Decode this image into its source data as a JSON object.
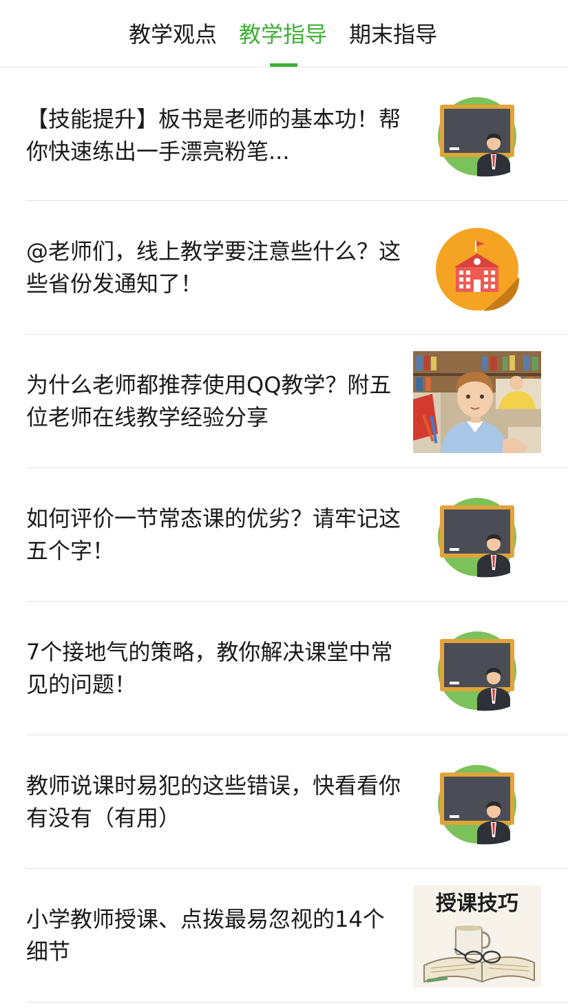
{
  "tabs": [
    {
      "label": "教学观点",
      "active": false
    },
    {
      "label": "教学指导",
      "active": true
    },
    {
      "label": "期末指导",
      "active": false
    }
  ],
  "accent_color": "#3cb035",
  "articles": [
    {
      "title": "【技能提升】板书是老师的基本功！帮你快速练出一手漂亮粉笔...",
      "thumbnail": "teacher-blackboard-icon"
    },
    {
      "title": "@老师们，线上教学要注意些什么？这些省份发通知了！",
      "thumbnail": "school-building-icon"
    },
    {
      "title": "为什么老师都推荐使用QQ教学？附五位老师在线教学经验分享",
      "thumbnail": "classroom-boy-photo"
    },
    {
      "title": "如何评价一节常态课的优劣？请牢记这五个字！",
      "thumbnail": "teacher-blackboard-icon"
    },
    {
      "title": "7个接地气的策略，教你解决课堂中常见的问题！",
      "thumbnail": "teacher-blackboard-icon"
    },
    {
      "title": "教师说课时易犯的这些错误，快看看你有没有（有用）",
      "thumbnail": "teacher-blackboard-icon"
    },
    {
      "title": "小学教师授课、点拨最易忽视的14个细节",
      "thumbnail": "teaching-tips-image",
      "thumbnail_text": "授课技巧"
    }
  ]
}
